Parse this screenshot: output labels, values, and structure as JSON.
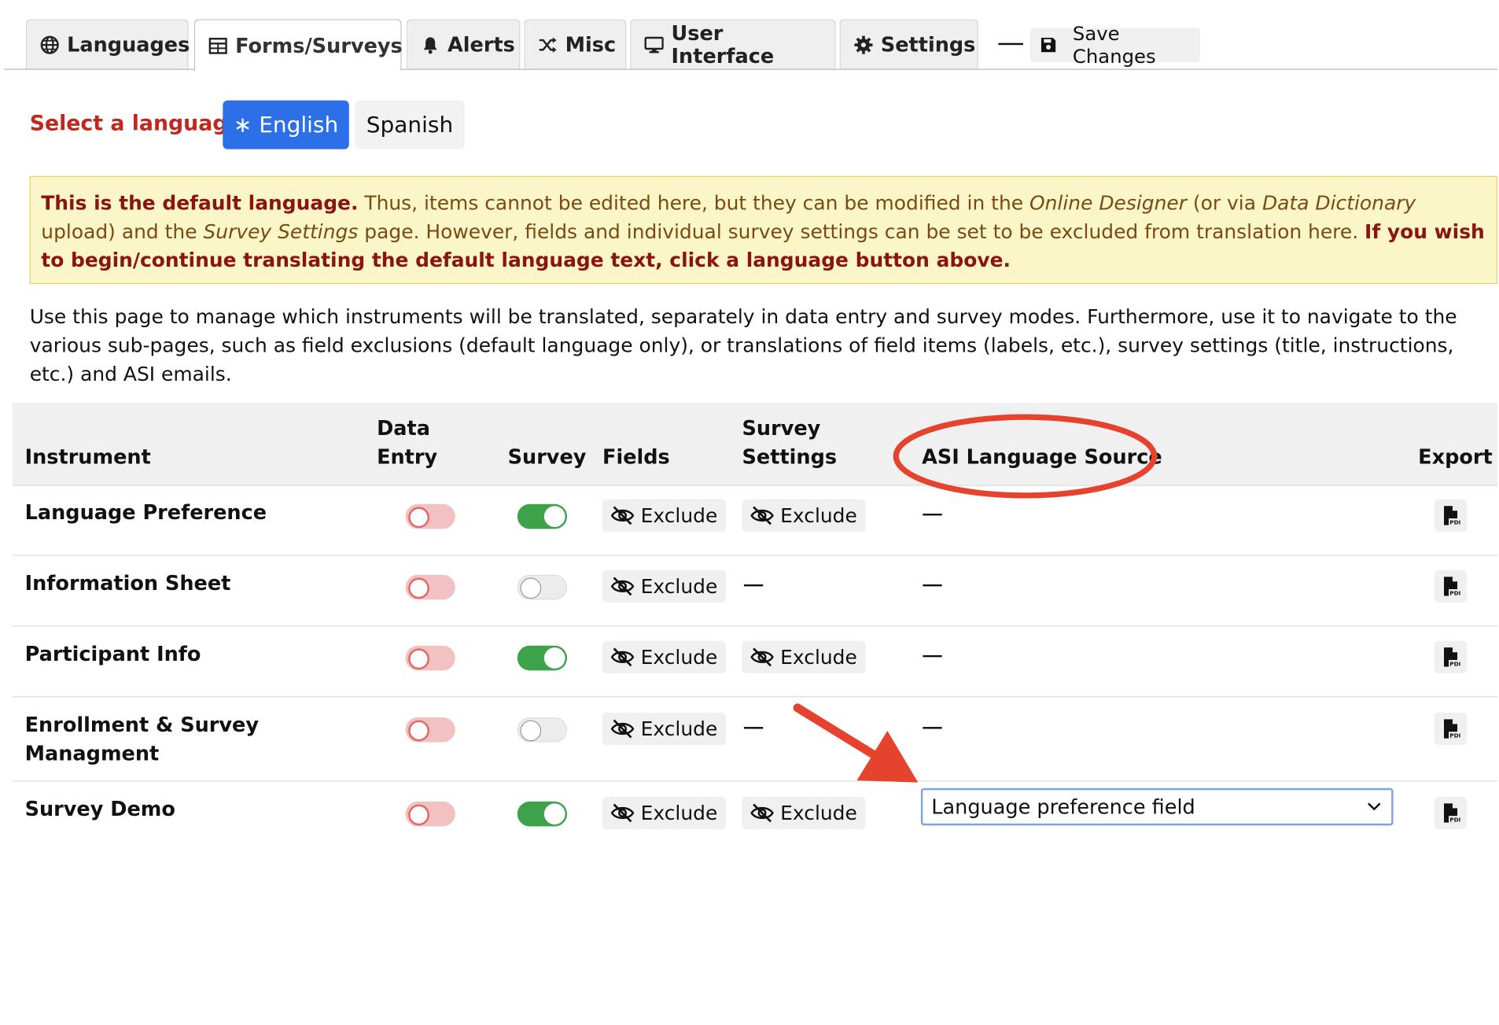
{
  "tabs": [
    {
      "label": "Languages",
      "icon": "globe-icon"
    },
    {
      "label": "Forms/Surveys",
      "icon": "table-icon",
      "active": true
    },
    {
      "label": "Alerts",
      "icon": "bell-icon"
    },
    {
      "label": "Misc",
      "icon": "shuffle-icon"
    },
    {
      "label": "User Interface",
      "icon": "desktop-icon"
    },
    {
      "label": "Settings",
      "icon": "gear-icon"
    }
  ],
  "save": {
    "label": "Save Changes",
    "icon": "floppy-disk-icon"
  },
  "language_selector": {
    "label": "Select a language:",
    "languages": [
      {
        "label": "∗ English",
        "selected": true
      },
      {
        "label": "Spanish",
        "selected": false
      }
    ]
  },
  "notice": {
    "bold_lead": "This is the default language.",
    "text1": " Thus, items cannot be edited here, but they can be modified in the ",
    "italic1": "Online Designer",
    "text2": " (or via ",
    "italic2": "Data Dictionary",
    "text3": " upload) and the ",
    "italic3": "Survey Settings",
    "text4": " page. However, fields and individual survey settings can be set to be excluded from translation here. ",
    "bold_tail": "If you wish to begin/continue translating the default language text, click a language button above."
  },
  "intro": "Use this page to manage which instruments will be translated, separately in data entry and survey modes. Furthermore, use it to navigate to the various sub-pages, such as field exclusions (default language only), or translations of field items (labels, etc.), survey settings (title, instructions, etc.) and ASI emails.",
  "table": {
    "headers": {
      "instrument": "Instrument",
      "data_entry_1": "Data",
      "data_entry_2": "Entry",
      "survey": "Survey",
      "fields": "Fields",
      "survey_settings_1": "Survey",
      "survey_settings_2": "Settings",
      "asi_language_source": "ASI Language Source",
      "export": "Export"
    },
    "exclude_label": "Exclude",
    "rows": [
      {
        "name": "Language Preference",
        "data_entry": false,
        "survey": true,
        "survey_settings": "exclude",
        "asi": "—"
      },
      {
        "name": "Information Sheet",
        "data_entry": false,
        "survey": false,
        "survey_settings": "—",
        "asi": "—"
      },
      {
        "name": "Participant Info",
        "data_entry": false,
        "survey": true,
        "survey_settings": "exclude",
        "asi": "—"
      },
      {
        "name_line1": "Enrollment & Survey",
        "name_line2": "Managment",
        "data_entry": false,
        "survey": false,
        "survey_settings": "—",
        "asi": "—"
      },
      {
        "name": "Survey Demo",
        "data_entry": false,
        "survey": true,
        "survey_settings": "exclude",
        "asi_select": "Language preference field"
      }
    ]
  },
  "colors": {
    "accent": "#2c6fe6",
    "toggle_on": "#3ca34b",
    "toggle_off_red": "#f2c1c1",
    "annotation": "#e5432d",
    "warning_bg": "#fbf6c8"
  }
}
